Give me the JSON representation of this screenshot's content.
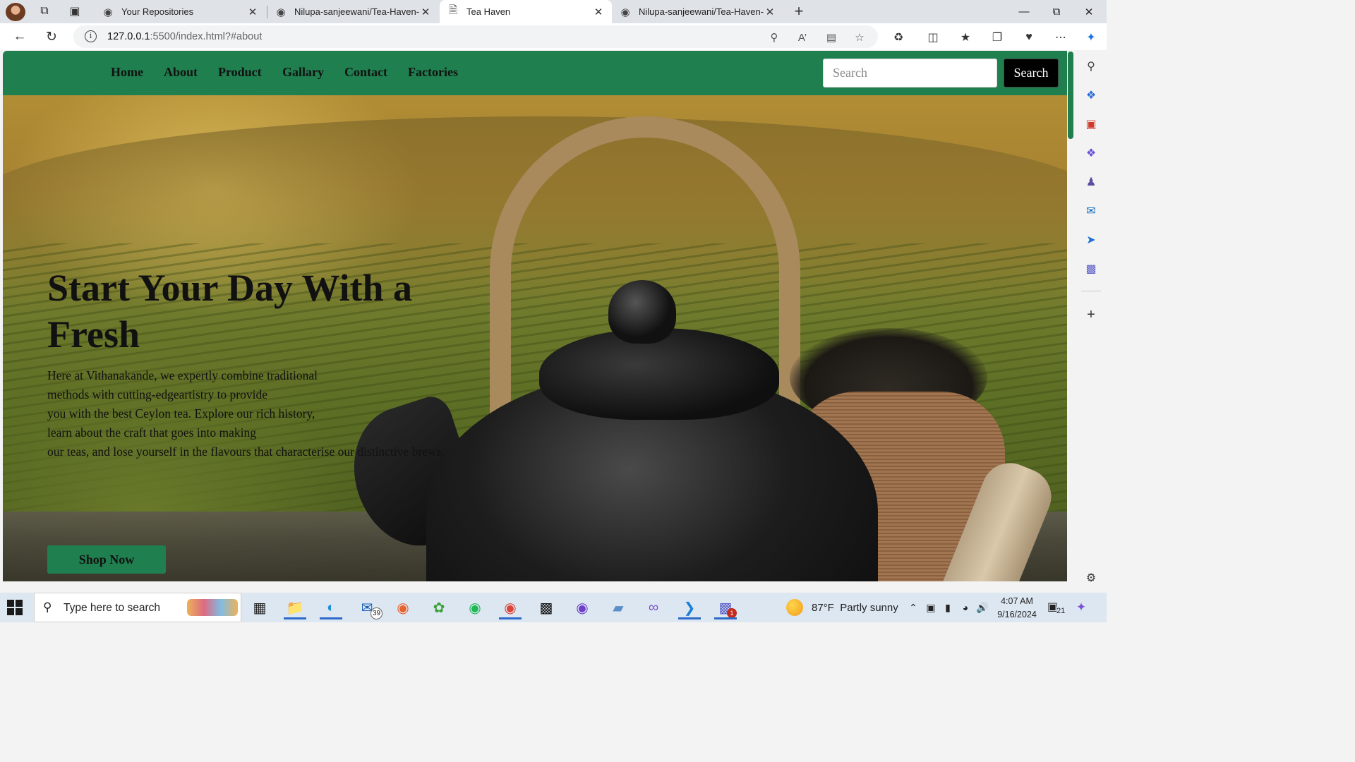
{
  "browser": {
    "tabs": [
      {
        "title": "Your Repositories",
        "icon": "github-icon",
        "active": false
      },
      {
        "title": "Nilupa-sanjeewani/Tea-Haven-W",
        "icon": "github-icon",
        "active": false
      },
      {
        "title": "Tea Haven",
        "icon": "page-icon",
        "active": true
      },
      {
        "title": "Nilupa-sanjeewani/Tea-Haven-W",
        "icon": "github-icon",
        "active": false
      }
    ],
    "url_host": "127.0.0.1",
    "url_rest": ":5500/index.html?#about"
  },
  "site": {
    "nav": [
      "Home",
      "About",
      "Product",
      "Gallary",
      "Contact",
      "Factories"
    ],
    "search_placeholder": "Search",
    "search_button": "Search",
    "hero_title": "Start Your Day With a Fresh",
    "hero_text": "Here at Vithanakande, we expertly combine traditional\nmethods with cutting-edgeartistry to provide\nyou with the best Ceylon tea. Explore our rich history,\nlearn about the craft that goes into making\nour teas, and lose yourself in the flavours that characterise our distinctive brews.",
    "shop_button": "Shop Now",
    "brand_color": "#1f7f4f"
  },
  "taskbar": {
    "search_placeholder": "Type here to search",
    "mail_badge": "39",
    "teams_badge": "1",
    "weather_temp": "87°F",
    "weather_desc": "Partly sunny",
    "time": "4:07 AM",
    "date": "9/16/2024",
    "notif_count": "21"
  }
}
